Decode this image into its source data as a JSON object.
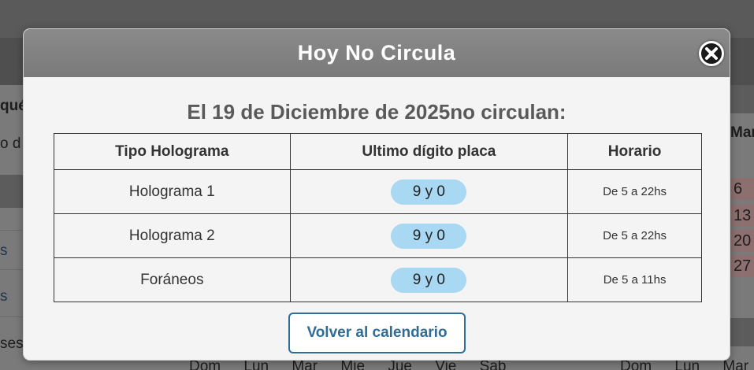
{
  "background": {
    "fragments": {
      "que": "qué",
      "o_d": "o d",
      "s1": "s",
      "s2": "s",
      "ses": "ses",
      "mar_header": "Mar"
    },
    "calendar_days": [
      "6",
      "13",
      "20",
      "27"
    ],
    "weekdays_left": [
      "Dom",
      "Lun",
      "Mar",
      "Mie",
      "Jue",
      "Vie",
      "Sab"
    ],
    "weekdays_right": [
      "Dom",
      "Lun",
      "Mar"
    ]
  },
  "modal": {
    "title": "Hoy No Circula",
    "close_icon": "close-icon",
    "heading": "El 19 de Diciembre de 2025no circulan:",
    "table": {
      "headers": [
        "Tipo Holograma",
        "Ultimo dígito placa",
        "Horario"
      ],
      "rows": [
        {
          "tipo": "Holograma 1",
          "digitos": "9 y 0",
          "horario": "De 5 a 22hs"
        },
        {
          "tipo": "Holograma 2",
          "digitos": "9 y 0",
          "horario": "De 5 a 22hs"
        },
        {
          "tipo": "Foráneos",
          "digitos": "9 y 0",
          "horario": "De 5 a 11hs"
        }
      ]
    },
    "back_button": "Volver al calendario"
  },
  "colors": {
    "header_bg": "#808080",
    "pill_bg": "#a8d8f2",
    "button_accent": "#2f6d97",
    "heading_text": "#5a5a5a"
  }
}
